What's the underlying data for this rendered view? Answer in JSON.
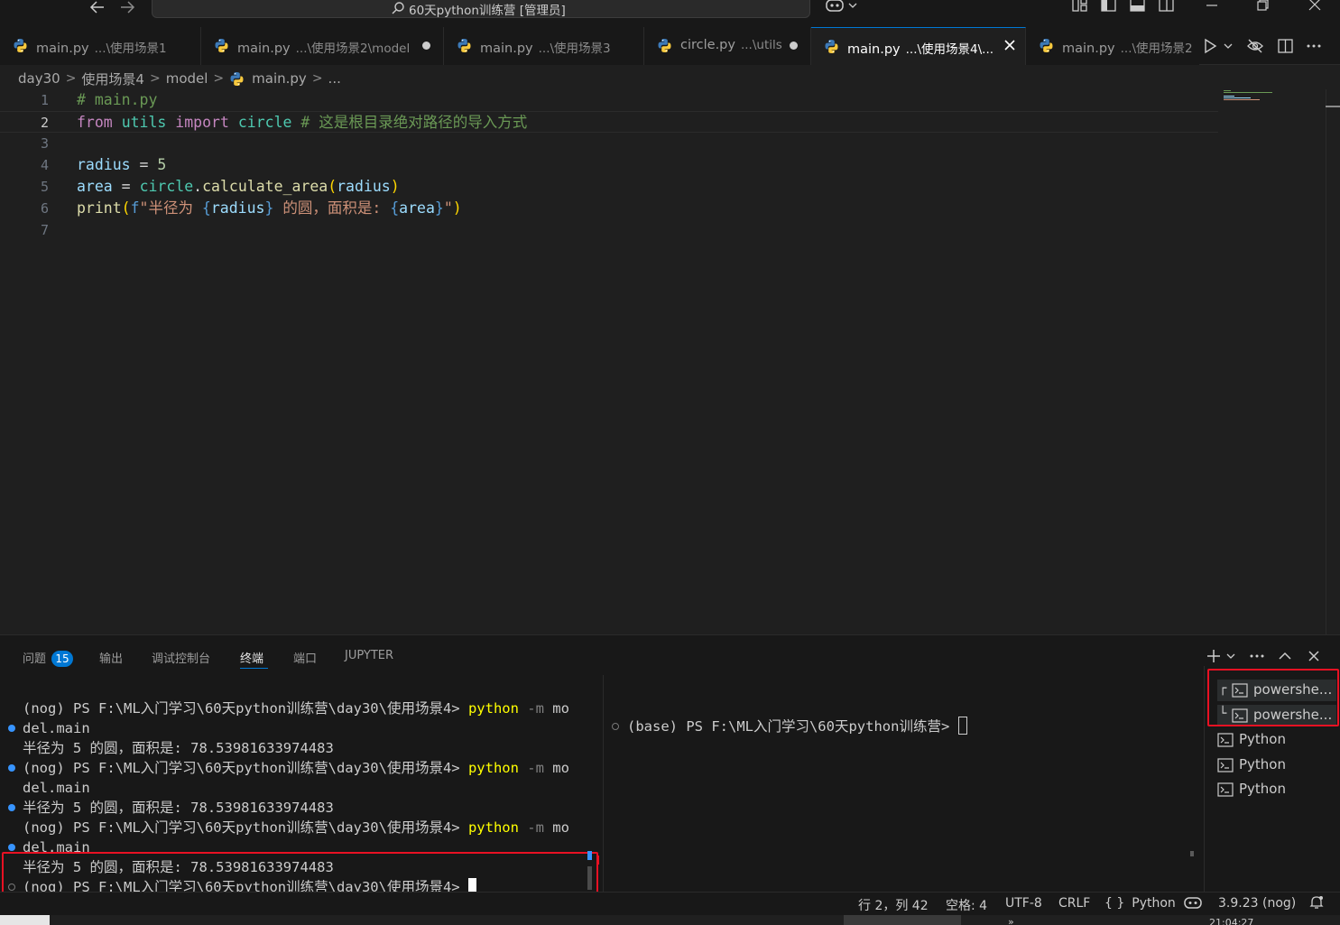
{
  "titlebar": {
    "title": "60天python训练营 [管理员]",
    "back_icon": "arrow-left-icon",
    "forward_icon": "arrow-right-icon"
  },
  "tabs": [
    {
      "name": "main.py",
      "path": "...\\使用场景1",
      "dirty": false,
      "active": false
    },
    {
      "name": "main.py",
      "path": "...\\使用场景2\\model",
      "dirty": true,
      "active": false
    },
    {
      "name": "main.py",
      "path": "...\\使用场景3",
      "dirty": false,
      "active": false
    },
    {
      "name": "circle.py",
      "path": "...\\utils",
      "dirty": true,
      "active": false
    },
    {
      "name": "main.py",
      "path": "...\\使用场景4\\...",
      "dirty": false,
      "active": true
    },
    {
      "name": "main.py",
      "path": "...\\使用场景2",
      "dirty": false,
      "active": false
    }
  ],
  "breadcrumb": [
    "day30",
    "使用场景4",
    "model",
    "main.py",
    "..."
  ],
  "editor": {
    "current_line": 2,
    "lines": [
      {
        "num": "1",
        "parts": [
          {
            "c": "c-com",
            "t": "# main.py"
          }
        ]
      },
      {
        "num": "2",
        "parts": [
          {
            "c": "c-kw",
            "t": "from"
          },
          {
            "c": "c-op",
            "t": " "
          },
          {
            "c": "c-mod",
            "t": "utils"
          },
          {
            "c": "c-op",
            "t": " "
          },
          {
            "c": "c-kw",
            "t": "import"
          },
          {
            "c": "c-op",
            "t": " "
          },
          {
            "c": "c-mod",
            "t": "circle"
          },
          {
            "c": "c-op",
            "t": " "
          },
          {
            "c": "c-com",
            "t": "# 这是根目录绝对路径的导入方式"
          }
        ]
      },
      {
        "num": "3",
        "parts": []
      },
      {
        "num": "4",
        "parts": [
          {
            "c": "c-var",
            "t": "radius"
          },
          {
            "c": "c-op",
            "t": " = "
          },
          {
            "c": "c-num",
            "t": "5"
          }
        ]
      },
      {
        "num": "5",
        "parts": [
          {
            "c": "c-var",
            "t": "area"
          },
          {
            "c": "c-op",
            "t": " = "
          },
          {
            "c": "c-mod",
            "t": "circle"
          },
          {
            "c": "c-op",
            "t": "."
          },
          {
            "c": "c-fn",
            "t": "calculate_area"
          },
          {
            "c": "c-br1",
            "t": "("
          },
          {
            "c": "c-var",
            "t": "radius"
          },
          {
            "c": "c-br1",
            "t": ")"
          }
        ]
      },
      {
        "num": "6",
        "parts": [
          {
            "c": "c-fn",
            "t": "print"
          },
          {
            "c": "c-br1",
            "t": "("
          },
          {
            "c": "c-fstr",
            "t": "f"
          },
          {
            "c": "c-str",
            "t": "\"半径为 "
          },
          {
            "c": "c-fstr",
            "t": "{"
          },
          {
            "c": "c-var",
            "t": "radius"
          },
          {
            "c": "c-fstr",
            "t": "}"
          },
          {
            "c": "c-str",
            "t": " 的圆，面积是: "
          },
          {
            "c": "c-fstr",
            "t": "{"
          },
          {
            "c": "c-var",
            "t": "area"
          },
          {
            "c": "c-fstr",
            "t": "}"
          },
          {
            "c": "c-str",
            "t": "\""
          },
          {
            "c": "c-br1",
            "t": ")"
          }
        ]
      },
      {
        "num": "7",
        "parts": []
      }
    ]
  },
  "panel": {
    "tabs": [
      "问题",
      "输出",
      "调试控制台",
      "终端",
      "端口",
      "JUPYTER"
    ],
    "active_tab": "终端",
    "problems_count": "15",
    "terminal_left": [
      {
        "text": "(nog) PS F:\\ML入门学习\\60天python训练营\\day30\\使用场景4> ",
        "cmd": "python",
        "arg": " -m ",
        "tail": "mo",
        "deco": "none"
      },
      {
        "text": "del.main",
        "deco": "blue"
      },
      {
        "text": "半径为 5 的圆，面积是: 78.53981633974483",
        "deco": "none"
      },
      {
        "text": "(nog) PS F:\\ML入门学习\\60天python训练营\\day30\\使用场景4> ",
        "cmd": "python",
        "arg": " -m ",
        "tail": "mo",
        "deco": "blue"
      },
      {
        "text": "del.main",
        "deco": "none"
      },
      {
        "text": "半径为 5 的圆，面积是: 78.53981633974483",
        "deco": "blue"
      },
      {
        "text": "(nog) PS F:\\ML入门学习\\60天python训练营\\day30\\使用场景4> ",
        "cmd": "python",
        "arg": " -m ",
        "tail": "mo",
        "deco": "none"
      },
      {
        "text": "del.main",
        "deco": "blue"
      },
      {
        "text": "半径为 5 的圆，面积是: 78.53981633974483",
        "deco": "none"
      },
      {
        "text": "(nog) PS F:\\ML入门学习\\60天python训练营\\day30\\使用场景4> ",
        "deco": "hollow",
        "cursor": true
      }
    ],
    "terminal_right": "(base) PS F:\\ML入门学习\\60天python训练营> ",
    "terminal_list": [
      {
        "label": "powershe...",
        "tree": "┌",
        "selected": true
      },
      {
        "label": "powershe...",
        "tree": "└",
        "selected": true
      },
      {
        "label": "Python",
        "tree": "",
        "selected": false
      },
      {
        "label": "Python",
        "tree": "",
        "selected": false
      },
      {
        "label": "Python",
        "tree": "",
        "selected": false
      }
    ]
  },
  "statusbar": {
    "cursor_pos": "行 2，列 42",
    "spaces": "空格: 4",
    "encoding": "UTF-8",
    "eol": "CRLF",
    "language": "Python",
    "interpreter": "3.9.23 (nog)"
  },
  "taskbar": {
    "clock": "21:04:27",
    "chevron": "»"
  },
  "colors": {
    "accent": "#0078d4",
    "highlight_box": "#e81123",
    "editor_bg": "#1f1f1f",
    "chrome_bg": "#181818"
  }
}
